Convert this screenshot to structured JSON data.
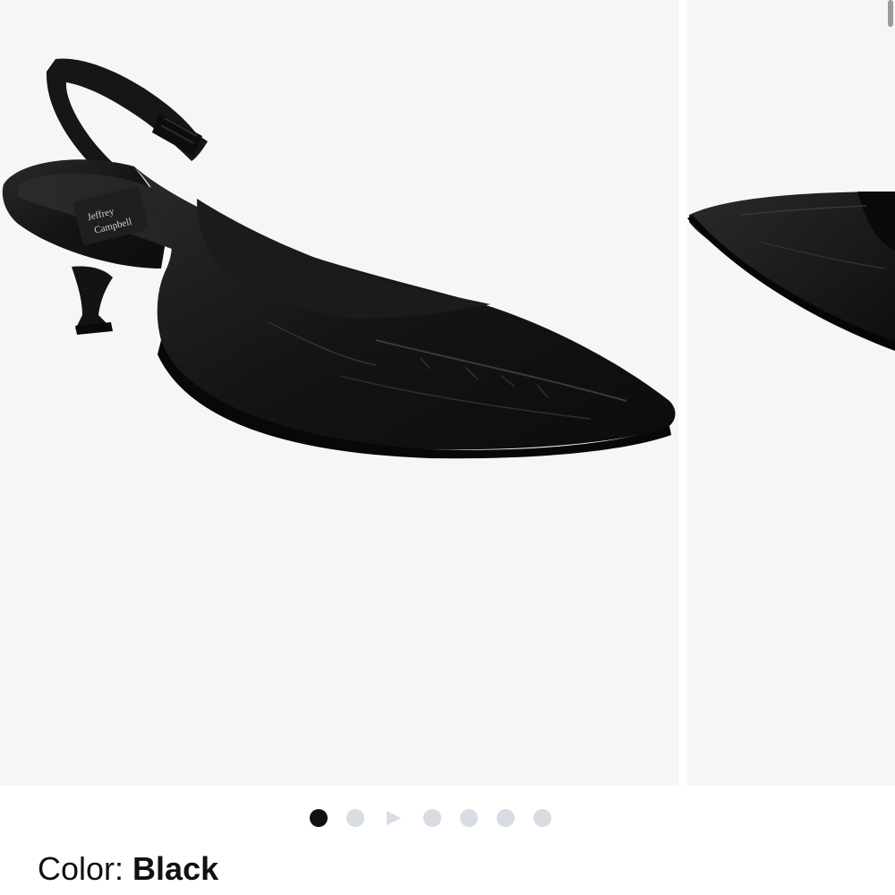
{
  "product": {
    "images": [
      {
        "name": "side-view",
        "alt": "Black kitten heel slingback pump, side view",
        "brand_mark": "Jeffrey Campbell"
      },
      {
        "name": "toe-closeup",
        "alt": "Black slingback pump toe closeup"
      }
    ],
    "carousel": {
      "total": 7,
      "active_index": 0,
      "video_index": 2
    },
    "color": {
      "label": "Color:",
      "value": "Black"
    }
  },
  "colors": {
    "background": "#f6f6f7",
    "dot_active": "#111111",
    "dot_inactive": "#d7dde3",
    "text": "#111111",
    "shoe": "#151515"
  }
}
